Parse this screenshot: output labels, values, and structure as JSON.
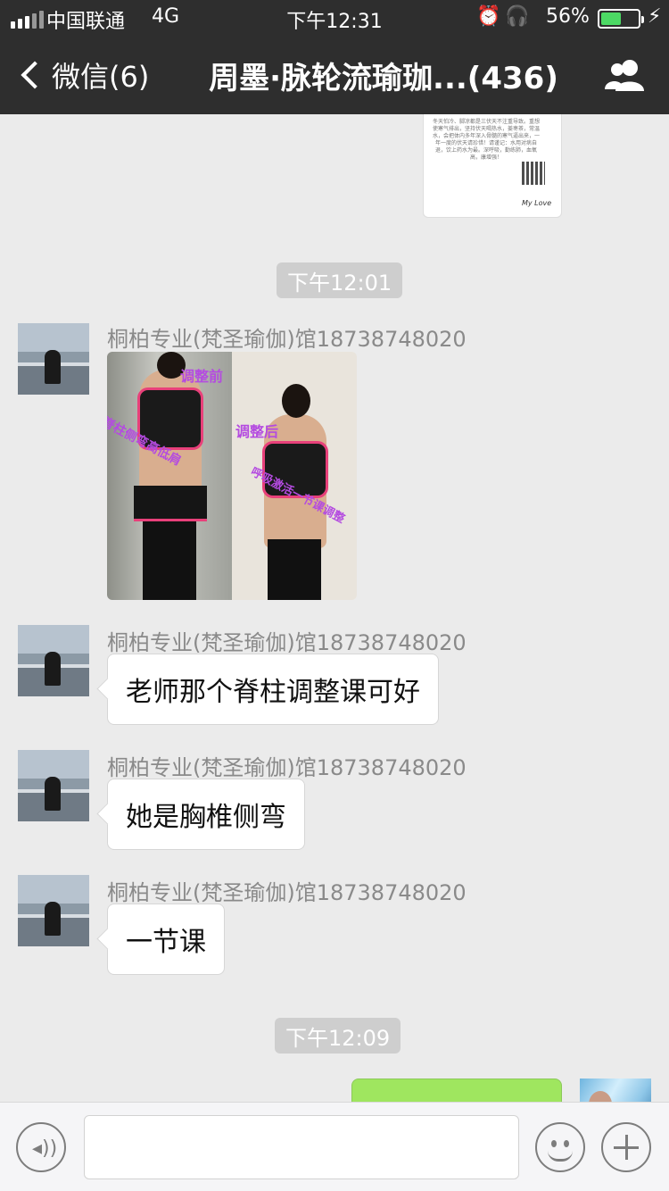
{
  "status_bar": {
    "carrier": "中国联通",
    "network": "4G",
    "time": "下午12:31",
    "battery_percent": "56%",
    "battery_level": 0.56
  },
  "nav": {
    "back_label": "微信(6)",
    "title": "周墨·脉轮流瑜珈...(436)"
  },
  "top_card": {
    "text": "冬天怕冷、脚凉都是三伏天不注重导致。重想使寒气排出，坚持伏天喝热水，姜枣茶，常温水，会把体内多年深入骨髓的寒气逼出来，一年一度的伏天请珍惜！请谨记：水用对病自退，饮上药水为最。深呼吸，勤练肺，血氧高，康增强！",
    "signature": "My Love"
  },
  "timestamps": [
    "下午12:01",
    "下午12:09"
  ],
  "messages": [
    {
      "sender": "桐柏专业(梵圣瑜伽)馆18738748020",
      "type": "image",
      "image_captions": [
        "调整前",
        "脊柱侧弯高低肩",
        "调整后",
        "呼吸激活一节课调整"
      ]
    },
    {
      "sender": "桐柏专业(梵圣瑜伽)馆18738748020",
      "type": "text",
      "text": "老师那个脊柱调整课可好"
    },
    {
      "sender": "桐柏专业(梵圣瑜伽)馆18738748020",
      "type": "text",
      "text": "她是胸椎侧弯"
    },
    {
      "sender": "桐柏专业(梵圣瑜伽)馆18738748020",
      "type": "text",
      "text": "一节课"
    }
  ],
  "icons": [
    "signal-icon",
    "alarm-icon",
    "headphones-icon",
    "battery-icon",
    "charging-icon",
    "back-chevron-icon",
    "group-members-icon",
    "voice-icon",
    "emoji-icon",
    "plus-icon"
  ],
  "colors": {
    "header": "#2e2e2e",
    "chat_bg": "#ebebeb",
    "sent_bubble": "#9fe65f",
    "timestamp_pill": "#cecece"
  }
}
